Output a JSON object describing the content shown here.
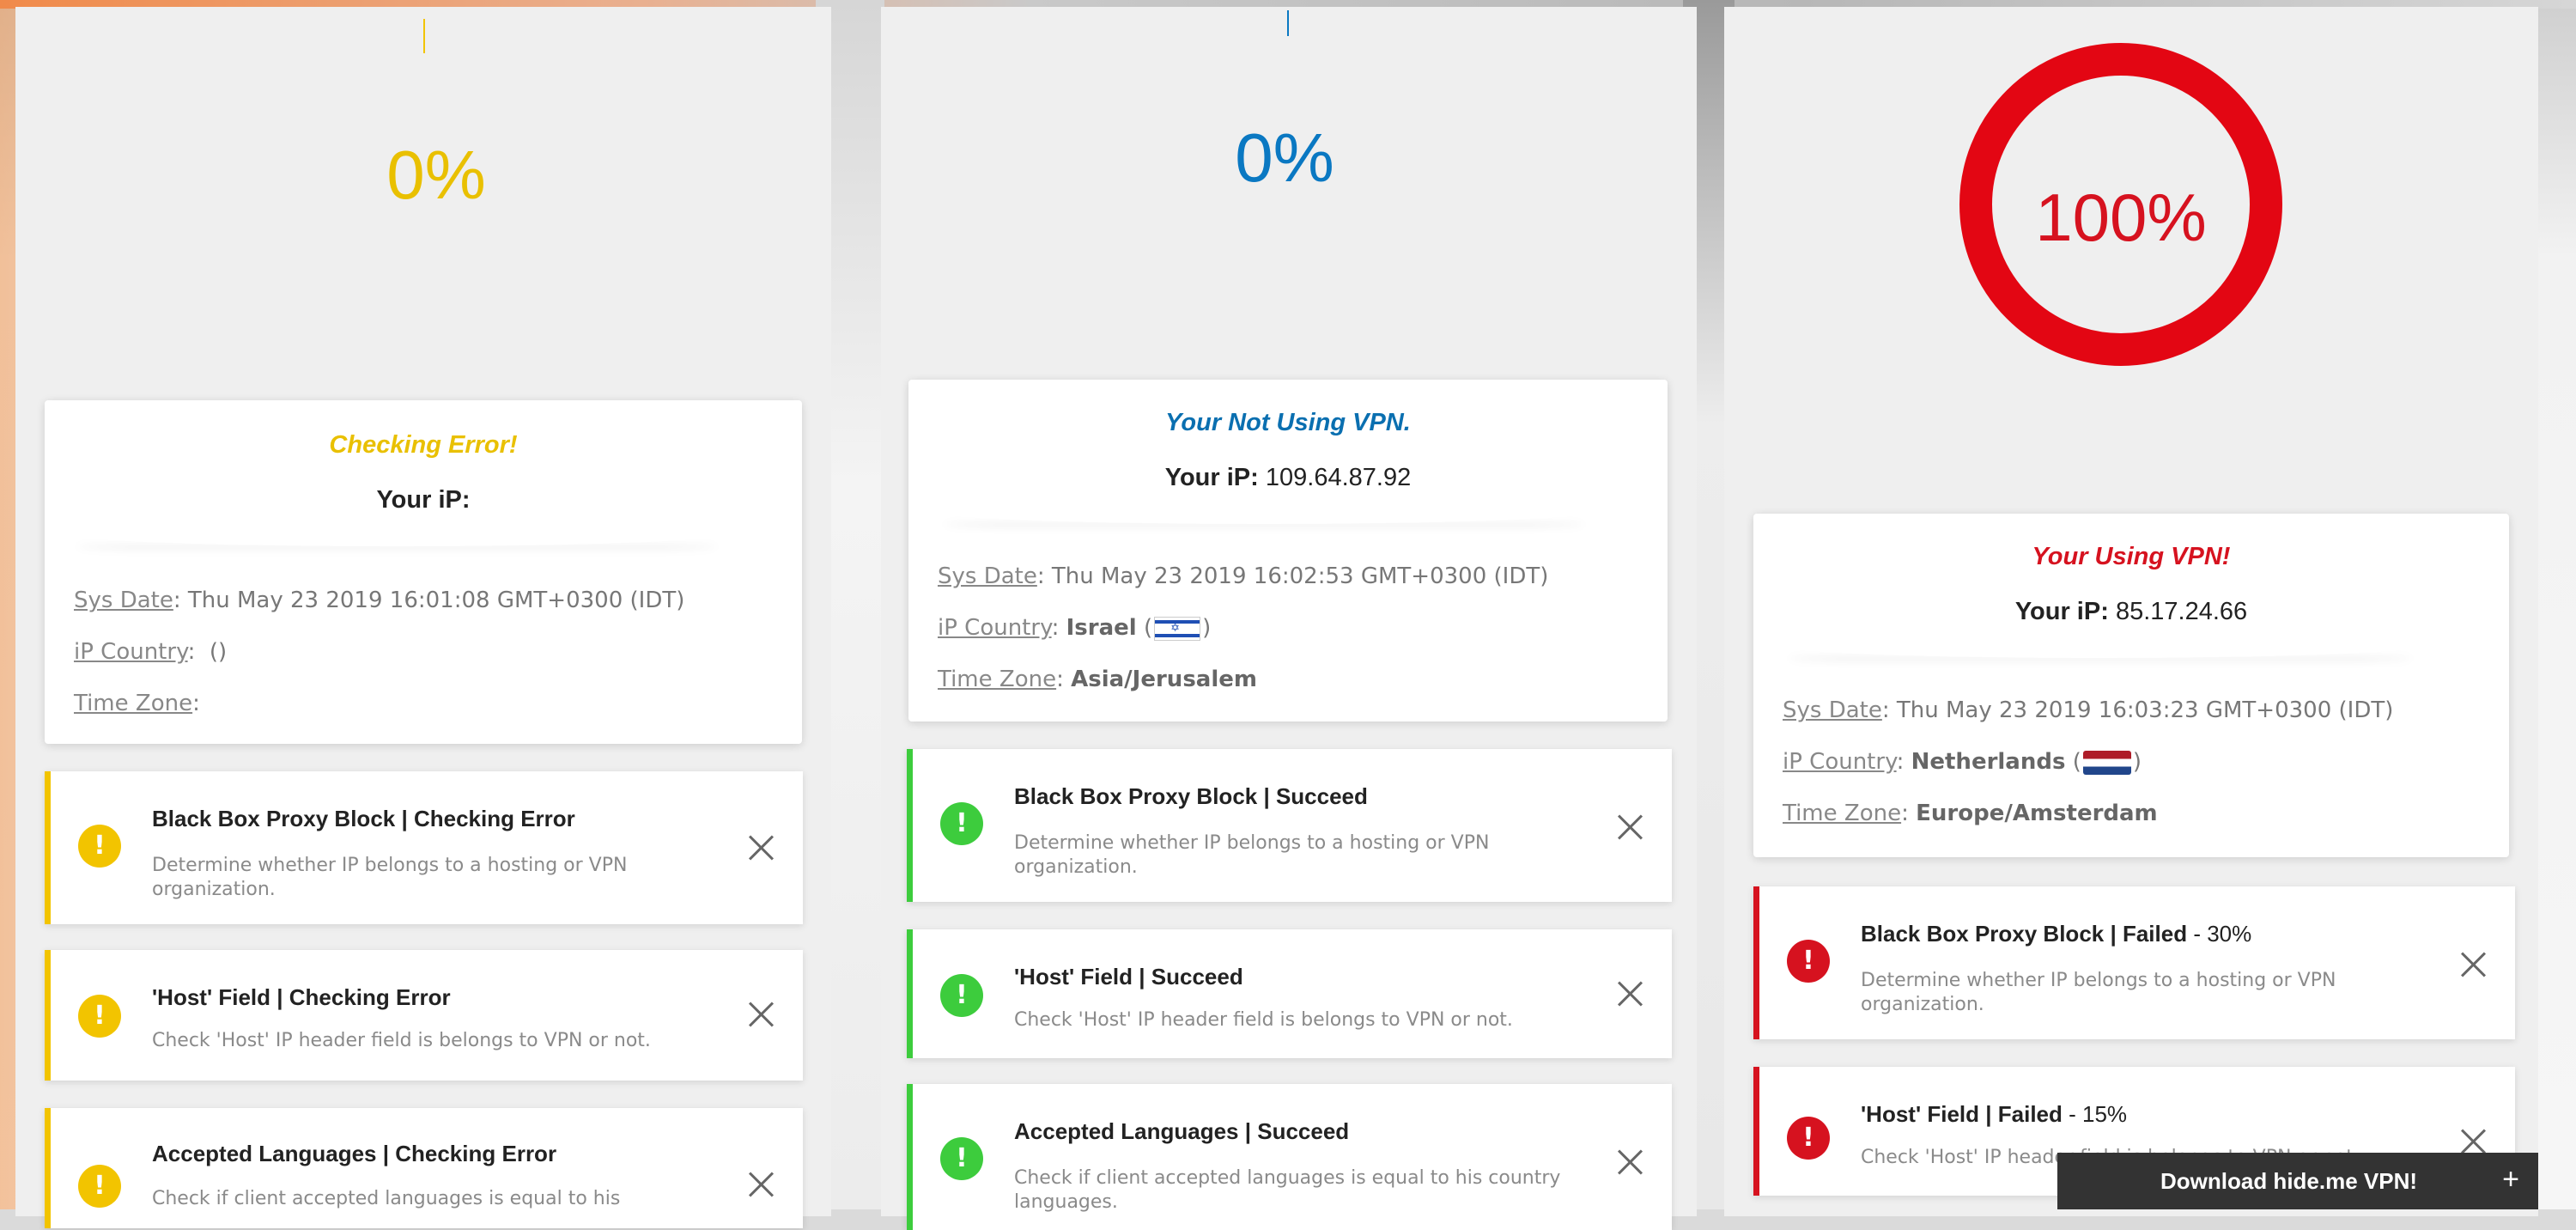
{
  "colors": {
    "yellow": "#f2c400",
    "blue": "#0a78c2",
    "red": "#d6121f",
    "green": "#3dcc3d"
  },
  "panels": [
    {
      "percent": "0%",
      "status": "Checking Error!",
      "ip_label": "Your iP:",
      "ip_value": "",
      "sys_date_label": "Sys Date",
      "sys_date": ": Thu May 23 2019 16:01:08 GMT+0300 (IDT)",
      "country_label": "iP Country",
      "country": ":  ()",
      "timezone_label": "Time Zone",
      "timezone": ":",
      "checks": [
        {
          "title": "Black Box Proxy Block | Checking Error",
          "suffix": "",
          "desc": "Determine whether IP belongs to a hosting or VPN organization.",
          "icon": "!"
        },
        {
          "title": "'Host' Field | Checking Error",
          "suffix": "",
          "desc": "Check 'Host' IP header field is belongs to VPN or not.",
          "icon": "!"
        },
        {
          "title": "Accepted Languages | Checking Error",
          "suffix": "",
          "desc": "Check if client accepted languages is equal to his",
          "icon": "!"
        }
      ]
    },
    {
      "percent": "0%",
      "status": "Your Not Using VPN.",
      "ip_label": "Your iP:",
      "ip_value": "109.64.87.92",
      "sys_date_label": "Sys Date",
      "sys_date": ": Thu May 23 2019 16:02:53 GMT+0300 (IDT)",
      "country_label": "iP Country",
      "country_sep": ": ",
      "country": "Israel",
      "country_flag": "israel-flag",
      "timezone_label": "Time Zone",
      "timezone_sep": ": ",
      "timezone": "Asia/Jerusalem",
      "checks": [
        {
          "title": "Black Box Proxy Block | Succeed",
          "suffix": "",
          "desc": "Determine whether IP belongs to a hosting or VPN organization.",
          "icon": "!"
        },
        {
          "title": "'Host' Field | Succeed",
          "suffix": "",
          "desc": "Check 'Host' IP header field is belongs to VPN or not.",
          "icon": "!"
        },
        {
          "title": "Accepted Languages | Succeed",
          "suffix": "",
          "desc": "Check if client accepted languages is equal to his country languages.",
          "icon": "!"
        }
      ]
    },
    {
      "percent": "100%",
      "status": "Your Using VPN!",
      "ip_label": "Your iP:",
      "ip_value": "85.17.24.66",
      "sys_date_label": "Sys Date",
      "sys_date": ": Thu May 23 2019 16:03:23 GMT+0300 (IDT)",
      "country_label": "iP Country",
      "country_sep": ": ",
      "country": "Netherlands",
      "country_flag": "netherlands-flag",
      "timezone_label": "Time Zone",
      "timezone_sep": ": ",
      "timezone": "Europe/Amsterdam",
      "checks": [
        {
          "title": "Black Box Proxy Block | Failed",
          "suffix": " - 30%",
          "desc": "Determine whether IP belongs to a hosting or VPN organization.",
          "icon": "!"
        },
        {
          "title": "'Host' Field | Failed",
          "suffix": " - 15%",
          "desc": "Check 'Host' IP header field is belongs to VPN or not.",
          "icon": "!"
        }
      ]
    }
  ],
  "download": {
    "label": "Download hide.me VPN!",
    "plus": "+"
  }
}
